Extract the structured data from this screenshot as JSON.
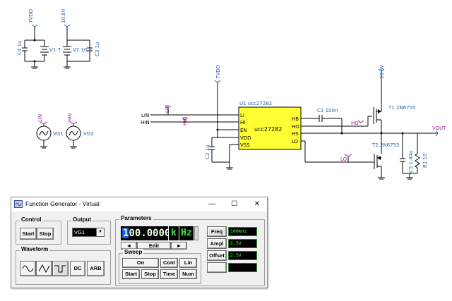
{
  "schematic": {
    "vdd_7": "7VDD",
    "v_10_8": "10.8V",
    "c4": "C4 1u",
    "v1": "V1 7",
    "v2": "V2 10.8",
    "c3": "C3 1u",
    "lin_net": "LIN",
    "hin_net": "HIN",
    "vg1": "VG1",
    "vg2": "VG2",
    "lin_port": "LIN",
    "hin_port": "HIN",
    "u1_title": "U1 ucc27282",
    "chip_name": "ucc27282",
    "pins_left": [
      "LI",
      "HI",
      "EN",
      "VDD",
      "VSS"
    ],
    "pins_right": [
      "HB",
      "HO",
      "HS",
      "LO"
    ],
    "vdd_u1": "7VDD",
    "c2": "C2 1u",
    "c1": "C1 100n",
    "ho": "HO",
    "lo": "LO",
    "v_top_right": "10.8V",
    "t1": "T1 2N6755",
    "t2": "T2 2N6755",
    "c5": "C5 1.44u",
    "r1": "R1 10",
    "vout": "VOUT"
  },
  "window": {
    "title": "Function Generator - Virtual",
    "minimize": "—",
    "maximize": "☐",
    "close": "✕"
  },
  "control": {
    "title": "Control",
    "start": "Start",
    "stop": "Stop"
  },
  "output": {
    "title": "Output",
    "selected": "VG1"
  },
  "waveform": {
    "title": "Waveform",
    "dc": "DC",
    "arb": "ARB"
  },
  "parameters": {
    "title": "Parameters",
    "value": "100.0000",
    "prefix": "k",
    "unit": "Hz",
    "edit": "Edit",
    "freq_label": "Freq",
    "freq_value": "100kHz",
    "ampl_label": "Ampl",
    "ampl_value": "2.5V",
    "offset_label": "Offset",
    "offset_value": "2.5V"
  },
  "sweep": {
    "title": "Sweep",
    "on": "On",
    "cont": "Cont",
    "lin": "Lin",
    "start": "Start",
    "stop": "Stop",
    "time": "Time",
    "num": "Num"
  }
}
